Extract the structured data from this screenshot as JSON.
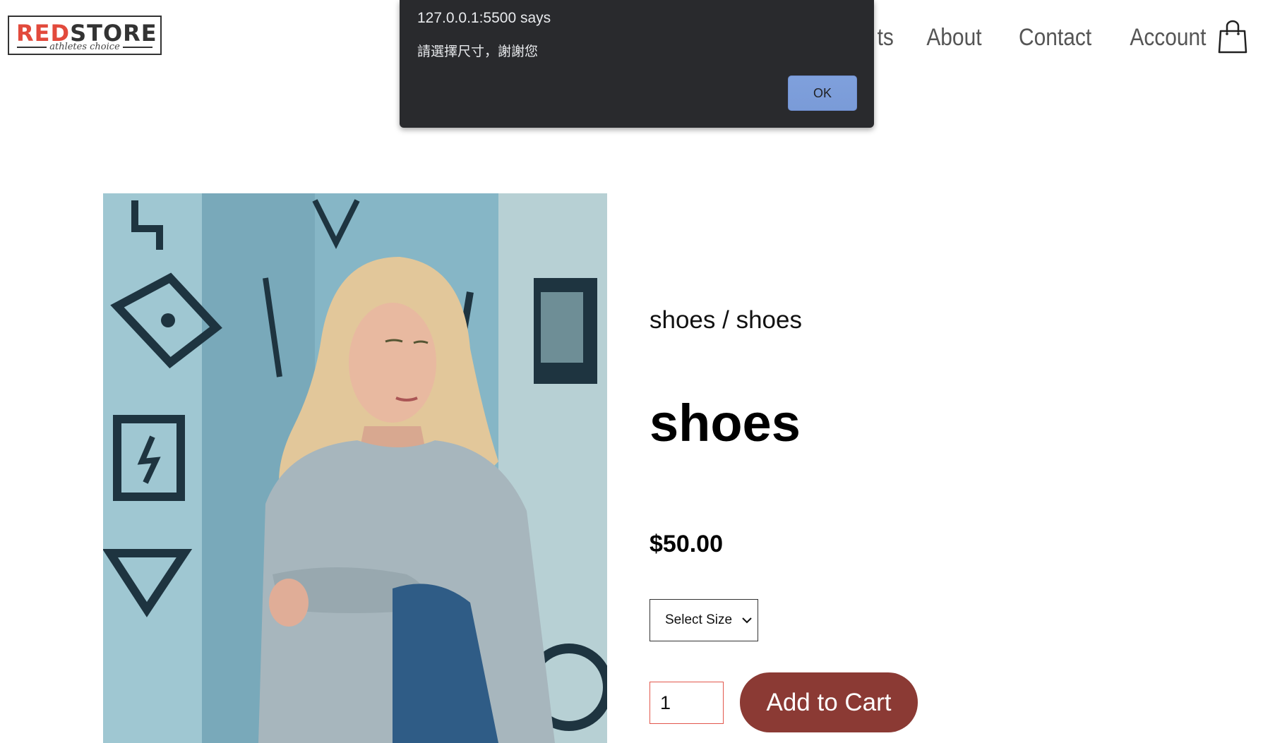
{
  "header": {
    "logo_text_red": "RED",
    "logo_text_dark": "STORE",
    "logo_tagline": "athletes choice",
    "nav": [
      "ts",
      "About",
      "Contact",
      "Account"
    ],
    "cart_icon": "shopping-bag-icon"
  },
  "alert": {
    "title": "127.0.0.1:5500 says",
    "message": "請選擇尺寸，謝謝您",
    "ok_label": "OK"
  },
  "product": {
    "breadcrumb": "shoes / shoes",
    "title": "shoes",
    "price": "$50.00",
    "size_select": {
      "selected": "Select Size"
    },
    "quantity": "1",
    "add_to_cart_label": "Add to Cart"
  },
  "colors": {
    "brand_red": "#e24a3c",
    "button_bg": "#8b3a34",
    "alert_bg": "#292a2d",
    "alert_ok_bg": "#7fa0dc"
  }
}
